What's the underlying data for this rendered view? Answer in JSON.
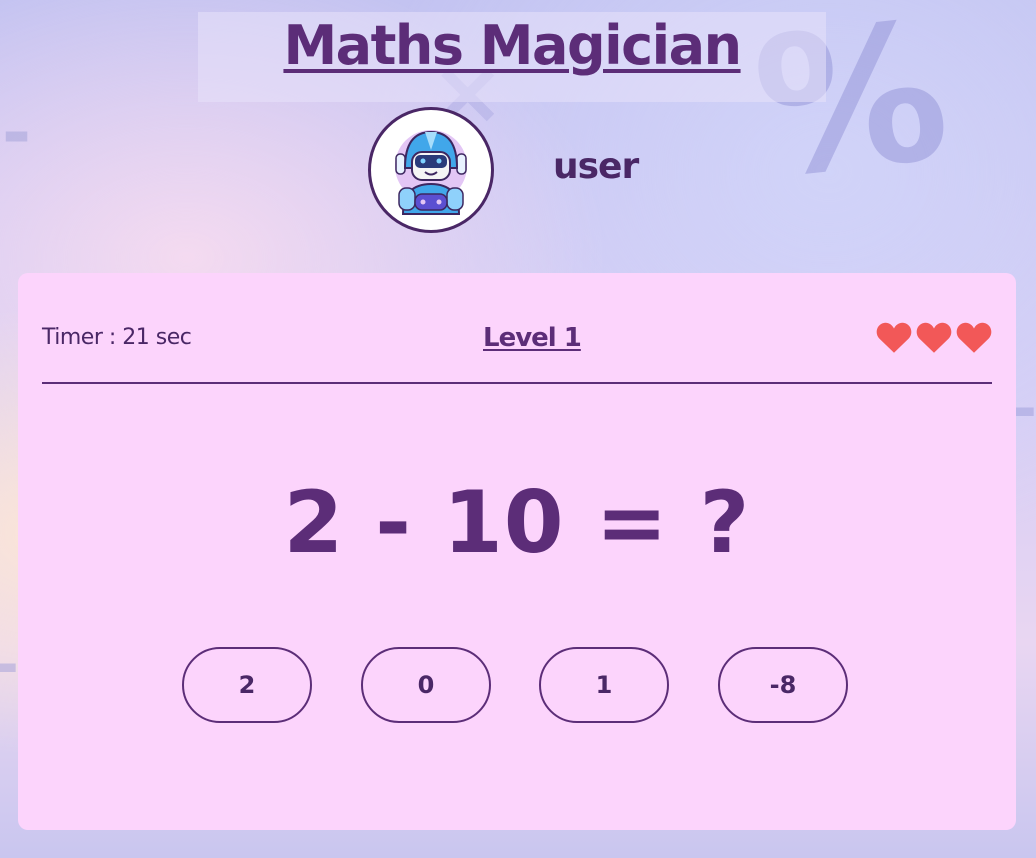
{
  "app": {
    "title": "Maths Magician",
    "username": "user"
  },
  "game": {
    "timer_text": "Timer : 21 sec",
    "level_text": "Level 1",
    "lives": 3,
    "question": "2 - 10 = ?",
    "answers": [
      "2",
      "0",
      "1",
      "-8"
    ]
  },
  "background_symbols": {
    "percent": "%",
    "minus": "-",
    "times": "×"
  },
  "colors": {
    "primary": "#5c2d78",
    "card_background": "#fcd4fc",
    "heart": "#f25858"
  },
  "icons": {
    "avatar": "robot-avatar-icon",
    "life": "heart-icon"
  }
}
